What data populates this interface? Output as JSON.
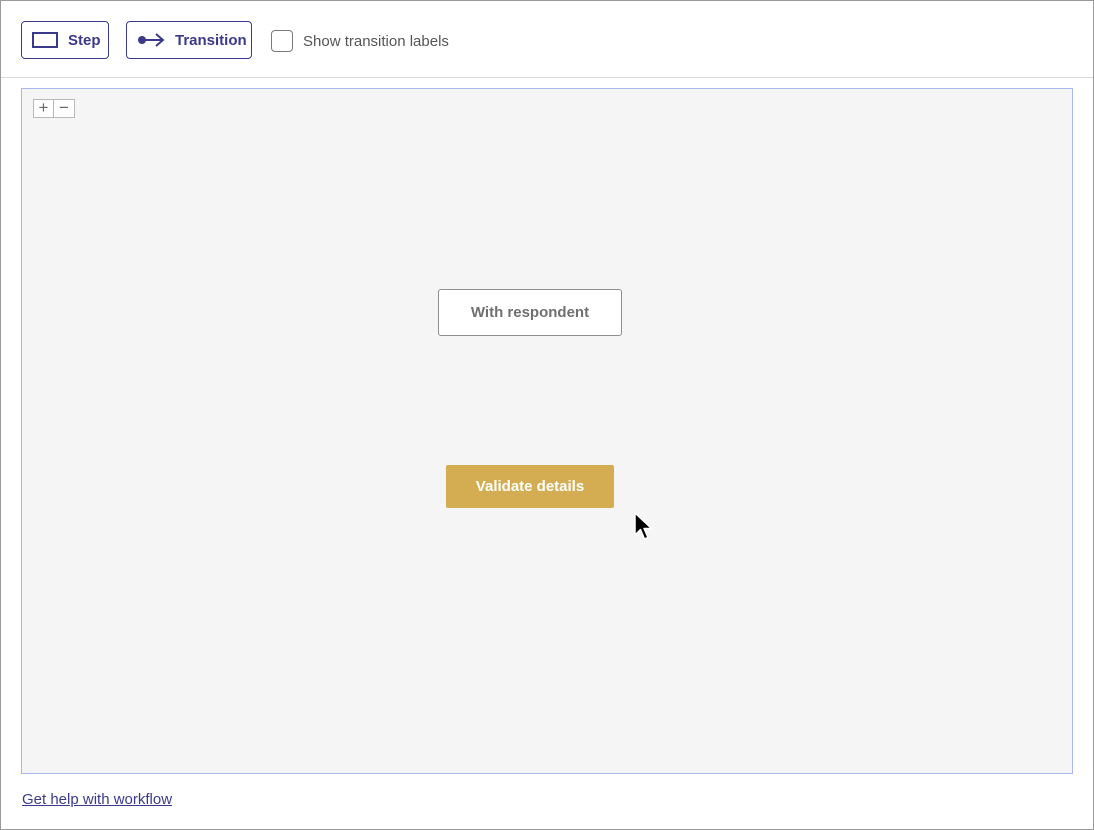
{
  "toolbar": {
    "step_label": "Step",
    "step_icon": "rectangle-icon",
    "transition_label": "Transition",
    "transition_icon": "arrow-connector-icon",
    "show_labels_text": "Show transition labels",
    "show_labels_checked": false
  },
  "canvas": {
    "zoom_in_label": "+",
    "zoom_out_label": "−",
    "nodes": [
      {
        "label": "With respondent",
        "style": "outlined"
      },
      {
        "label": "Validate details",
        "style": "filled",
        "color": "#d4ad52"
      }
    ]
  },
  "footer": {
    "help_link": "Get help with workflow"
  },
  "colors": {
    "accent": "#3b3a8a",
    "canvas_bg": "#f5f5f5",
    "canvas_border": "#a9b6ef",
    "validate_fill": "#d4ad52"
  }
}
